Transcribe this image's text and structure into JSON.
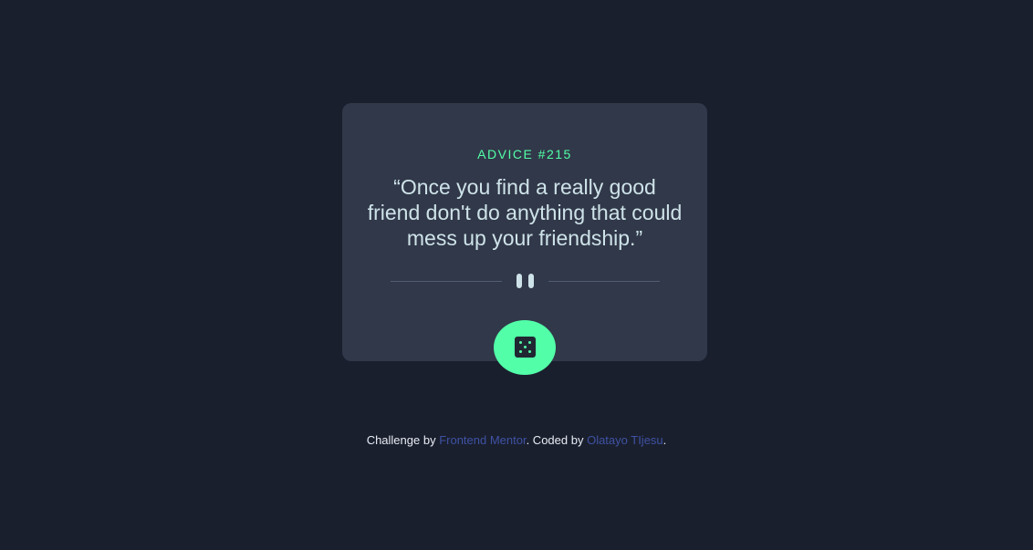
{
  "card": {
    "advice_label": "ADVICE #215",
    "advice_text": "“Once you find a really good friend don't do anything that could mess up your friendship.”"
  },
  "dice_button": {
    "icon": "dice-icon"
  },
  "footer": {
    "prefix": "Challenge by ",
    "link1": "Frontend Mentor",
    "middle": ". Coded by ",
    "link2": "Olatayo TIjesu",
    "suffix": "."
  },
  "colors": {
    "background": "#1a1f2e",
    "card": "#313849",
    "accent": "#52ffa8",
    "text": "#cee3e9",
    "link": "#3e52a3"
  }
}
